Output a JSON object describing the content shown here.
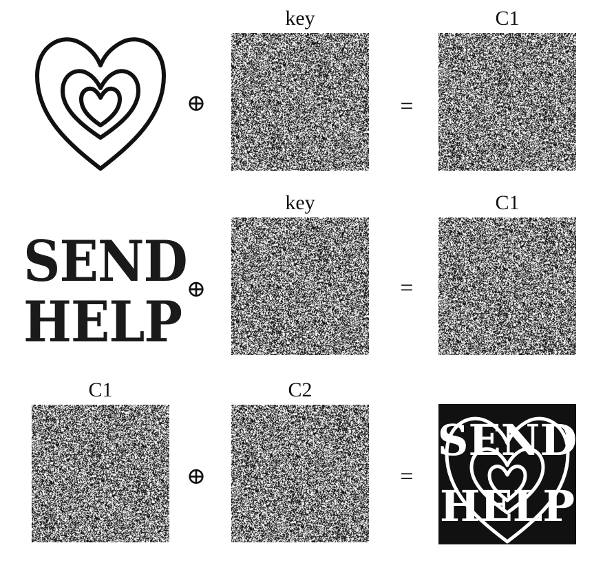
{
  "rows": [
    {
      "plaintext": "heart-image",
      "operator": "⊕",
      "key_label": "key",
      "equals": "=",
      "result_label": "C1"
    },
    {
      "plaintext_lines": [
        "SEND",
        "HELP"
      ],
      "operator": "⊕",
      "key_label": "key",
      "equals": "=",
      "result_label": "C1"
    },
    {
      "left_label": "C1",
      "operator": "⊕",
      "right_label": "C2",
      "equals": "=",
      "result_text": [
        "SEND",
        "HELP"
      ]
    }
  ],
  "colors": {
    "ink": "#111111",
    "paper": "#ffffff"
  }
}
